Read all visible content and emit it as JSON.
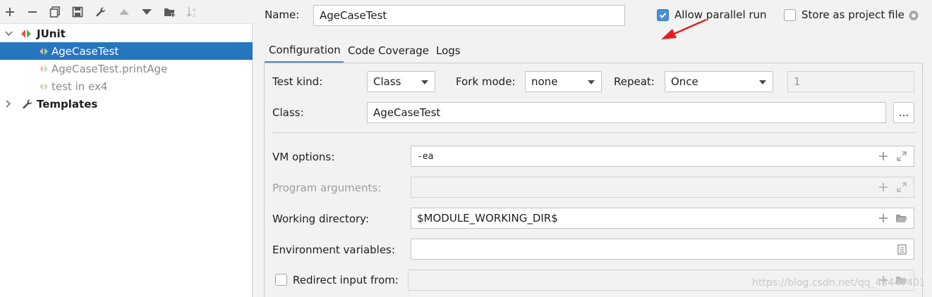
{
  "toolbar": {
    "icons": [
      "add-icon",
      "remove-icon",
      "copy-icon",
      "save-icon",
      "wrench-icon",
      "move-up-icon",
      "move-down-icon",
      "new-folder-icon",
      "sort-icon"
    ]
  },
  "tree": {
    "items": [
      {
        "label": "JUnit",
        "kind": "group",
        "expanded": true
      },
      {
        "label": "AgeCaseTest",
        "kind": "config",
        "selected": true
      },
      {
        "label": "AgeCaseTest.printAge",
        "kind": "config-temp"
      },
      {
        "label": "test in ex4",
        "kind": "config-temp"
      },
      {
        "label": "Templates",
        "kind": "group",
        "expanded": false
      }
    ]
  },
  "header": {
    "name_label": "Name:",
    "name_value": "AgeCaseTest",
    "allow_parallel_label": "Allow parallel run",
    "allow_parallel_checked": true,
    "store_project_label": "Store as project file",
    "store_project_checked": false
  },
  "tabs": [
    {
      "label": "Configuration",
      "active": true
    },
    {
      "label": "Code Coverage",
      "active": false
    },
    {
      "label": "Logs",
      "active": false
    }
  ],
  "config": {
    "test_kind_label": "Test kind:",
    "test_kind_value": "Class",
    "fork_mode_label": "Fork mode:",
    "fork_mode_value": "none",
    "repeat_label": "Repeat:",
    "repeat_value": "Once",
    "repeat_count": "1",
    "class_label": "Class:",
    "class_value": "AgeCaseTest",
    "browse_label": "...",
    "vm_options_label": "VM options:",
    "vm_options_value": "-ea",
    "program_args_label": "Program arguments:",
    "program_args_value": "",
    "working_dir_label": "Working directory:",
    "working_dir_value": "$MODULE_WORKING_DIR$",
    "env_vars_label": "Environment variables:",
    "env_vars_value": "",
    "redirect_label": "Redirect input from:",
    "redirect_checked": false,
    "redirect_value": ""
  },
  "watermark": "https://blog.csdn.net/qq_43447401",
  "colors": {
    "selection": "#2675bf",
    "tab_underline": "#4b8ad0",
    "checkbox_checked": "#4a8fd9",
    "annotation_arrow": "#e02020",
    "junit_green": "#4caf50",
    "junit_red": "#e0553d"
  }
}
